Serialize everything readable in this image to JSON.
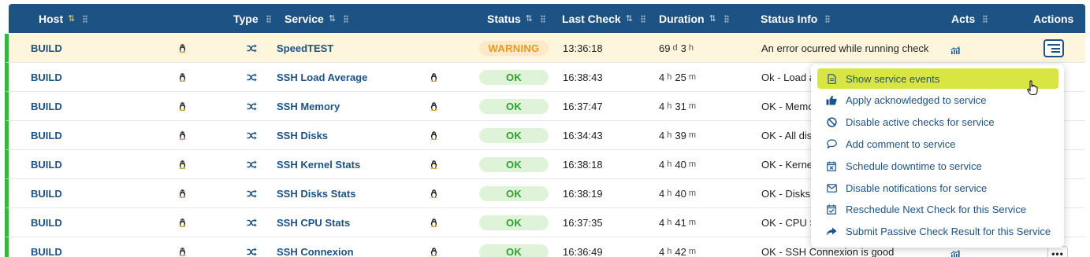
{
  "header": {
    "host": "Host",
    "type": "Type",
    "service": "Service",
    "status": "Status",
    "last_check": "Last Check",
    "duration": "Duration",
    "status_info": "Status Info",
    "acts": "Acts",
    "actions": "Actions"
  },
  "rows": [
    {
      "host": "BUILD",
      "service": "SpeedTEST",
      "status": "WARNING",
      "last_check": "13:36:18",
      "dur_a": "69",
      "dur_a_unit": "d",
      "dur_b": "3",
      "dur_b_unit": "h",
      "info": "An error ocurred while running check"
    },
    {
      "host": "BUILD",
      "service": "SSH Load Average",
      "status": "OK",
      "last_check": "16:38:43",
      "dur_a": "4",
      "dur_a_unit": "h",
      "dur_b": "25",
      "dur_b_unit": "m",
      "info": "Ok - Load a"
    },
    {
      "host": "BUILD",
      "service": "SSH Memory",
      "status": "OK",
      "last_check": "16:37:47",
      "dur_a": "4",
      "dur_a_unit": "h",
      "dur_b": "31",
      "dur_b_unit": "m",
      "info": "OK - Memo"
    },
    {
      "host": "BUILD",
      "service": "SSH Disks",
      "status": "OK",
      "last_check": "16:34:43",
      "dur_a": "4",
      "dur_a_unit": "h",
      "dur_b": "39",
      "dur_b_unit": "m",
      "info": "OK - All dis"
    },
    {
      "host": "BUILD",
      "service": "SSH Kernel Stats",
      "status": "OK",
      "last_check": "16:38:18",
      "dur_a": "4",
      "dur_a_unit": "h",
      "dur_b": "40",
      "dur_b_unit": "m",
      "info": "OK - Kerne"
    },
    {
      "host": "BUILD",
      "service": "SSH Disks Stats",
      "status": "OK",
      "last_check": "16:38:19",
      "dur_a": "4",
      "dur_a_unit": "h",
      "dur_b": "40",
      "dur_b_unit": "m",
      "info": "OK - Disks"
    },
    {
      "host": "BUILD",
      "service": "SSH CPU Stats",
      "status": "OK",
      "last_check": "16:37:35",
      "dur_a": "4",
      "dur_a_unit": "h",
      "dur_b": "41",
      "dur_b_unit": "m",
      "info": "OK - CPU S"
    },
    {
      "host": "BUILD",
      "service": "SSH Connexion",
      "status": "OK",
      "last_check": "16:36:49",
      "dur_a": "4",
      "dur_a_unit": "h",
      "dur_b": "42",
      "dur_b_unit": "m",
      "info": "OK - SSH Connexion is good"
    }
  ],
  "menu": [
    {
      "label": "Show service events",
      "icon": "document-icon"
    },
    {
      "label": "Apply acknowledged to service",
      "icon": "thumbs-up-icon"
    },
    {
      "label": "Disable active checks for service",
      "icon": "ban-icon"
    },
    {
      "label": "Add comment to service",
      "icon": "comment-icon"
    },
    {
      "label": "Schedule downtime to service",
      "icon": "calendar-x-icon"
    },
    {
      "label": "Disable notifications for service",
      "icon": "envelope-icon"
    },
    {
      "label": "Reschedule Next Check for this Service",
      "icon": "calendar-check-icon"
    },
    {
      "label": "Submit Passive Check Result for this Service",
      "icon": "share-icon"
    }
  ],
  "more_button": "•••",
  "colors": {
    "header_bg": "#1d5285",
    "ok_badge": "#dff3d8",
    "warning_badge": "#fde8c8",
    "highlight": "#d9e542",
    "row_bar": "#3bb43b"
  }
}
